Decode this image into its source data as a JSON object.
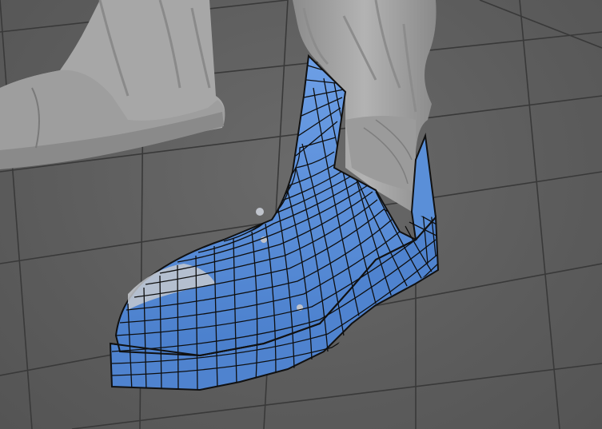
{
  "viewport": {
    "background_color": "#5e5e5e",
    "grid_color": "#3a3a3a",
    "sculpt_color": "#a9a9a9",
    "sculpt_shadow_color": "#7f7f7f",
    "retopo_mesh_color": "#5b8fd8",
    "retopo_wire_color": "#111111",
    "visible_text": []
  }
}
